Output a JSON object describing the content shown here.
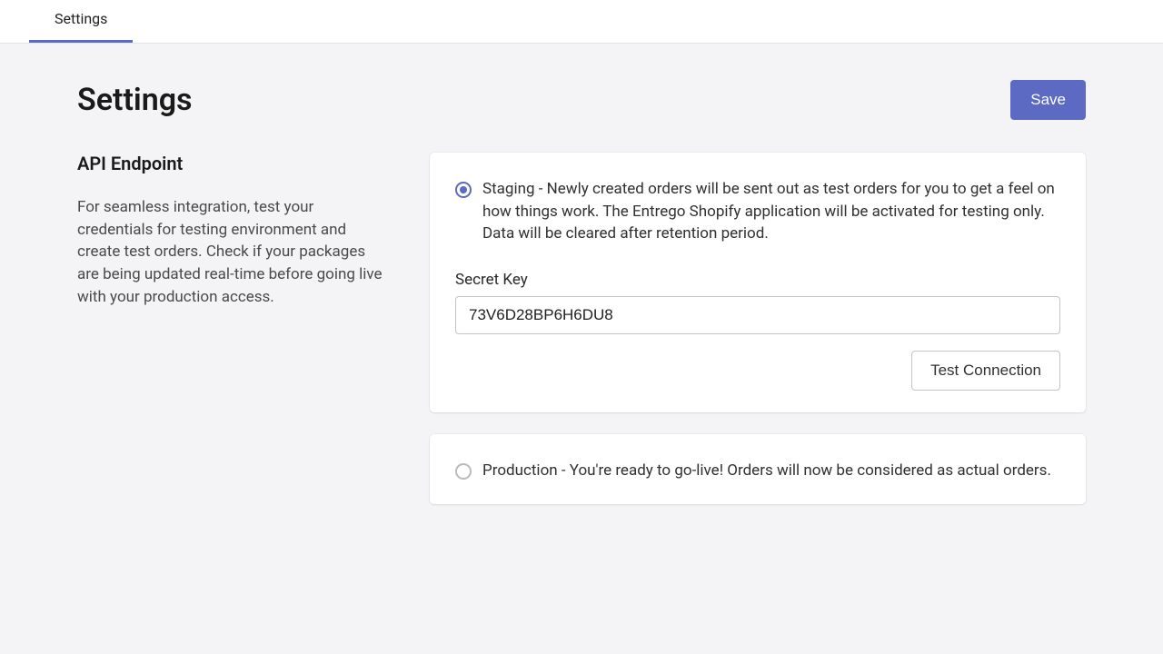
{
  "tabs": {
    "settings": "Settings"
  },
  "header": {
    "title": "Settings",
    "save_label": "Save"
  },
  "section": {
    "title": "API Endpoint",
    "description": "For seamless integration, test your credentials for testing environment and create test orders. Check if your packages are being updated real-time before going live with your production access."
  },
  "staging": {
    "label": "Staging - Newly created orders will be sent out as test orders for you to get a feel on how things work. The Entrego Shopify application will be activated for testing only. Data will be cleared after retention period.",
    "secret_key_label": "Secret Key",
    "secret_key_value": "73V6D28BP6H6DU8",
    "test_button": "Test Connection"
  },
  "production": {
    "label": "Production - You're ready to go-live! Orders will now be considered as actual orders."
  }
}
